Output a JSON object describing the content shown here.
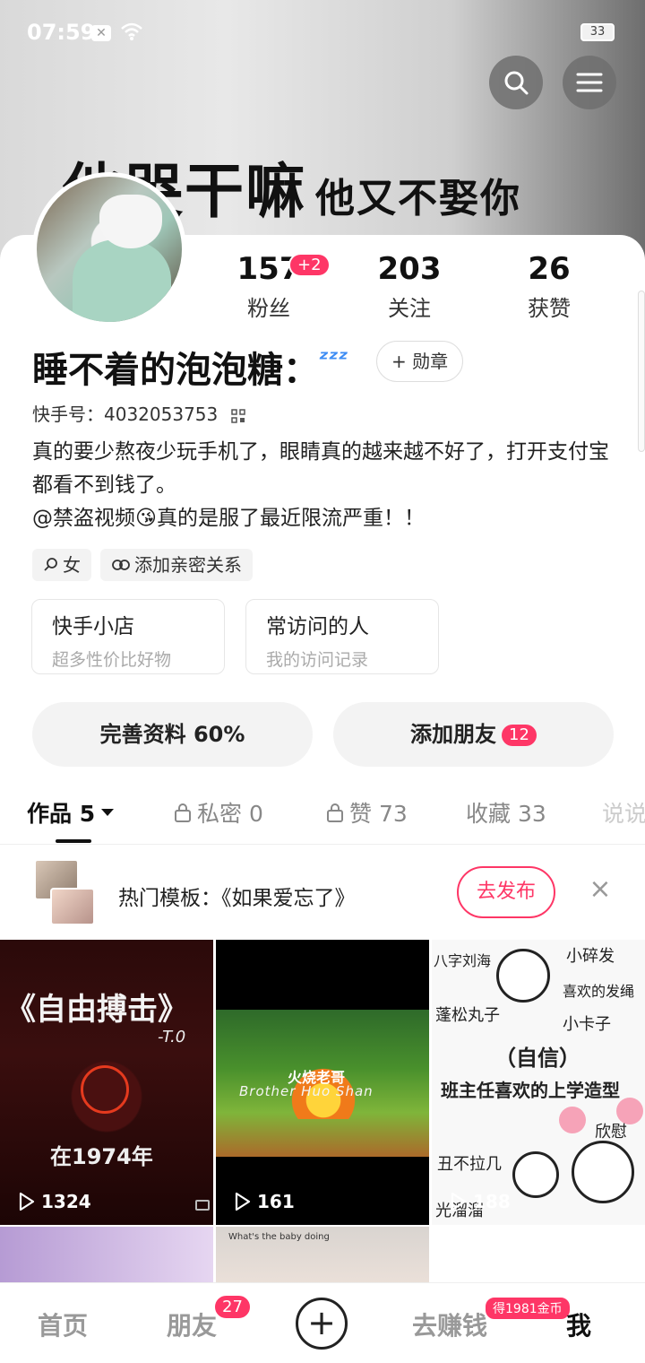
{
  "status_bar": {
    "time": "07:59",
    "battery": "33"
  },
  "banner": {
    "text": "他哭干嘛",
    "text_small": "他又不娶你"
  },
  "stats": {
    "fans": {
      "value": "157",
      "label": "粉丝",
      "badge": "+2"
    },
    "following": {
      "value": "203",
      "label": "关注"
    },
    "likes": {
      "value": "26",
      "label": "获赞"
    }
  },
  "profile": {
    "name": "睡不着的泡泡糖：",
    "emoji": "ᶻᶻᶻ",
    "medal_button": "+ 勋章",
    "kuaishou_id": "快手号：4032053753",
    "bio_line1": "真的要少熬夜少玩手机了，眼睛真的越来越不好了，打开支付宝都看不到钱了。",
    "bio_line2": "@禁盗视频😘真的是服了最近限流严重！！",
    "tags": [
      "女",
      "添加亲密关系"
    ]
  },
  "shortcuts": [
    {
      "title": "快手小店",
      "subtitle": "超多性价比好物"
    },
    {
      "title": "常访问的人",
      "subtitle": "我的访问记录"
    }
  ],
  "actions": {
    "complete": "完善资料 60%",
    "add_friend": "添加朋友",
    "add_friend_badge": "12"
  },
  "tabs": [
    {
      "label": "作品 5"
    },
    {
      "label": "私密 0"
    },
    {
      "label": "赞 73"
    },
    {
      "label": "收藏 33"
    },
    {
      "label": "说说"
    }
  ],
  "promo": {
    "text": "热门模板：《如果爱忘了》",
    "button": "去发布"
  },
  "videos": [
    {
      "title": "《自由搏击》",
      "subtitle": "-T.0",
      "caption": "在1974年",
      "plays": "1324"
    },
    {
      "caption": "火烧老哥",
      "caption2": "Brother Huo Shan",
      "plays": "161"
    },
    {
      "caption": "（自信）",
      "caption2": "班主任喜欢的上学造型",
      "words": [
        "八字刘海",
        "小碎发",
        "喜欢的发绳",
        "蓬松丸子",
        "小卡子",
        "欣慰",
        "丑不拉几",
        "光溜溜"
      ],
      "plays": "188"
    },
    {},
    {
      "caption": "What's the baby doing"
    }
  ],
  "bottom_nav": {
    "home": "首页",
    "friends": "朋友",
    "friends_badge": "27",
    "earn": "去赚钱",
    "earn_badge": "得1981金币",
    "me": "我"
  },
  "colors": {
    "accent": "#fe3666"
  }
}
